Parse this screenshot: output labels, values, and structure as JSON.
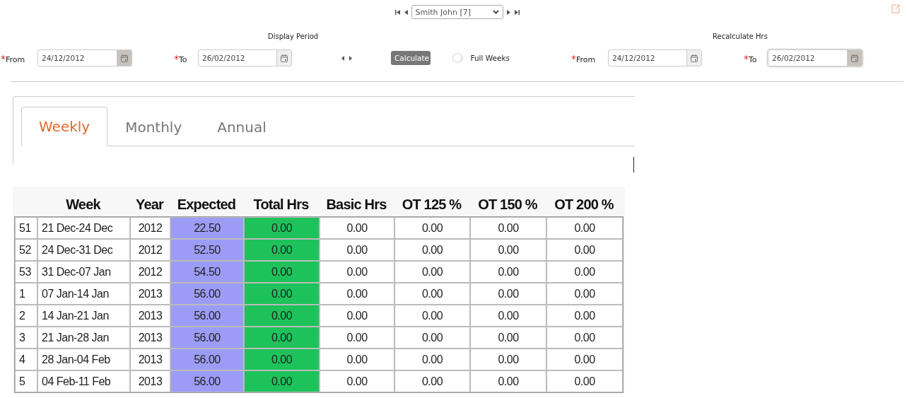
{
  "employee_nav": {
    "selected_employee": "Smith John [7]"
  },
  "display_period": {
    "title": "Display Period",
    "from": {
      "required_mark": "*",
      "label": "From",
      "value": "24/12/2012"
    },
    "to": {
      "required_mark": "*",
      "label": "To",
      "value": "26/02/2012"
    }
  },
  "calculate_button": "Calculate",
  "full_weeks": {
    "label": "Full Weeks",
    "on": false
  },
  "recalculate": {
    "title": "Recalculate Hrs",
    "from": {
      "required_mark": "*",
      "label": "From",
      "value": "24/12/2012"
    },
    "to": {
      "required_mark": "*",
      "label": "To",
      "value": "26/02/2012"
    }
  },
  "tabs": [
    {
      "label": "Weekly",
      "selected": true
    },
    {
      "label": "Monthly",
      "selected": false
    },
    {
      "label": "Annual",
      "selected": false
    }
  ],
  "table": {
    "columns": [
      {},
      {
        "label": "Week"
      },
      {
        "label": "Year"
      },
      {
        "label": "Expected",
        "color": "#9c9cf6"
      },
      {
        "label": "Total Hrs",
        "color": "#1ec25a"
      },
      {
        "label": "Basic Hrs"
      },
      {
        "label": "OT 125 %"
      },
      {
        "label": "OT 150 %"
      },
      {
        "label": "OT 200 %"
      }
    ],
    "rows": [
      [
        "51",
        "21 Dec-24 Dec",
        "2012",
        "22.50",
        "0.00",
        "0.00",
        "0.00",
        "0.00",
        "0.00"
      ],
      [
        "52",
        "24 Dec-31 Dec",
        "2012",
        "52.50",
        "0.00",
        "0.00",
        "0.00",
        "0.00",
        "0.00"
      ],
      [
        "53",
        "31 Dec-07 Jan",
        "2012",
        "54.50",
        "0.00",
        "0.00",
        "0.00",
        "0.00",
        "0.00"
      ],
      [
        "1",
        "07 Jan-14 Jan",
        "2013",
        "56.00",
        "0.00",
        "0.00",
        "0.00",
        "0.00",
        "0.00"
      ],
      [
        "2",
        "14 Jan-21 Jan",
        "2013",
        "56.00",
        "0.00",
        "0.00",
        "0.00",
        "0.00",
        "0.00"
      ],
      [
        "3",
        "21 Jan-28 Jan",
        "2013",
        "56.00",
        "0.00",
        "0.00",
        "0.00",
        "0.00",
        "0.00"
      ],
      [
        "4",
        "28 Jan-04 Feb",
        "2013",
        "56.00",
        "0.00",
        "0.00",
        "0.00",
        "0.00",
        "0.00"
      ],
      [
        "5",
        "04 Feb-11 Feb",
        "2013",
        "56.00",
        "0.00",
        "0.00",
        "0.00",
        "0.00",
        "0.00"
      ]
    ]
  }
}
